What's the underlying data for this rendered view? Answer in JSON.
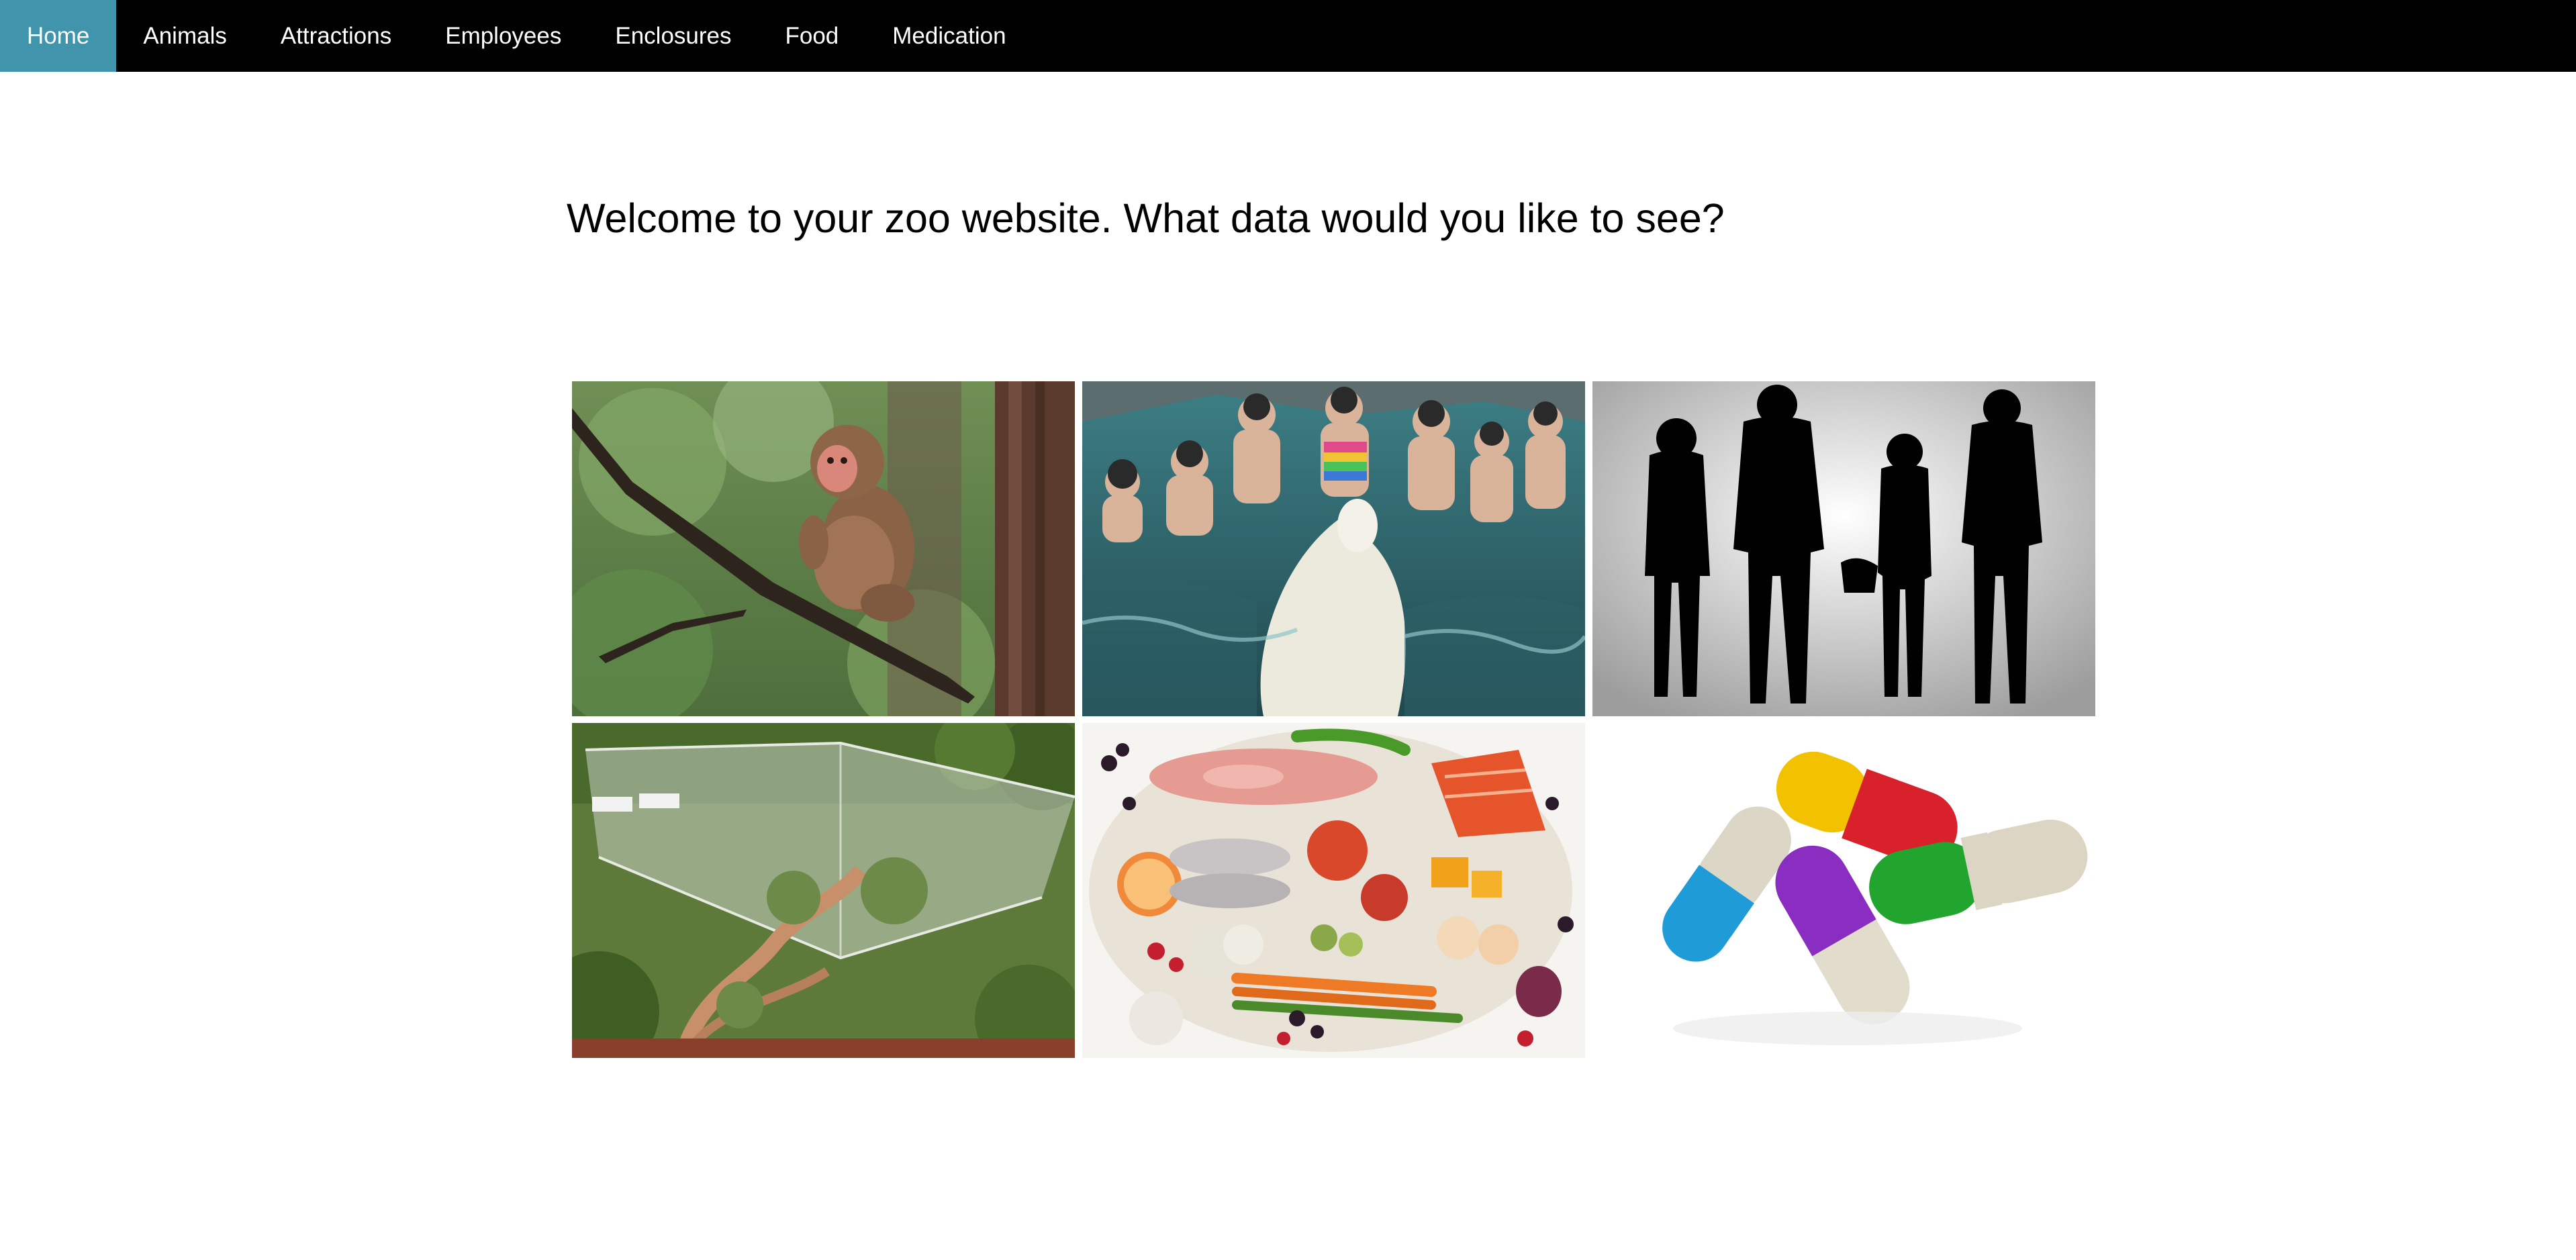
{
  "nav": {
    "items": [
      {
        "label": "Home",
        "active": true
      },
      {
        "label": "Animals",
        "active": false
      },
      {
        "label": "Attractions",
        "active": false
      },
      {
        "label": "Employees",
        "active": false
      },
      {
        "label": "Enclosures",
        "active": false
      },
      {
        "label": "Food",
        "active": false
      },
      {
        "label": "Medication",
        "active": false
      }
    ],
    "active_color": "#4095ad",
    "bar_color": "#000000"
  },
  "main": {
    "heading": "Welcome to your zoo website. What data would you like to see?"
  },
  "tiles": [
    {
      "icon": "monkey-photo"
    },
    {
      "icon": "polar-bear-swimmers-photo"
    },
    {
      "icon": "people-silhouettes-photo"
    },
    {
      "icon": "aviary-enclosure-photo"
    },
    {
      "icon": "fresh-food-photo"
    },
    {
      "icon": "capsule-pills-photo"
    }
  ]
}
